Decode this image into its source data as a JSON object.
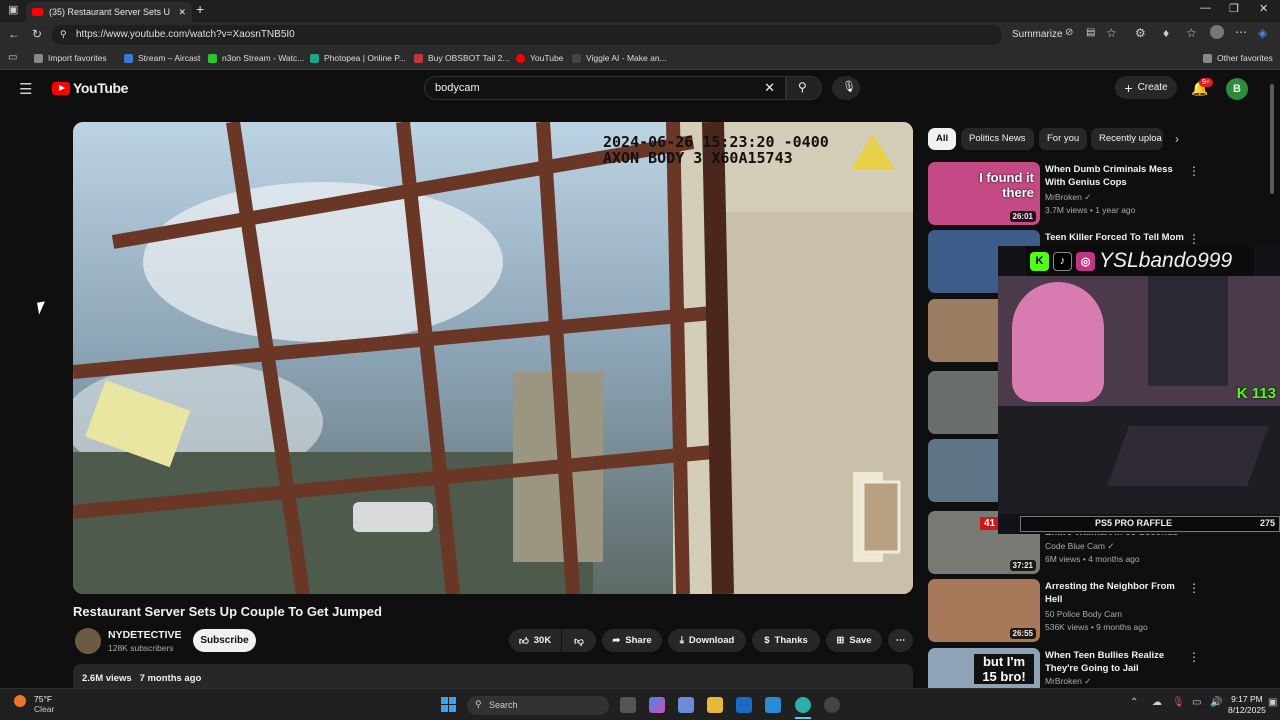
{
  "browser": {
    "tab_title": "(35) Restaurant Server Sets U",
    "url": "https://www.youtube.com/watch?v=XaosnTNB5I0",
    "summarize_label": "Summarize",
    "bookmarks": [
      "Import favorites",
      "Stream – Aircast",
      "n3on Stream - Watc...",
      "Photopea | Online P...",
      "Buy OBSBOT Tail 2...",
      "YouTube",
      "Viggle AI - Make an..."
    ],
    "other_favorites": "Other favorites"
  },
  "youtube": {
    "logo_text": "YouTube",
    "search_value": "bodycam",
    "create_label": "Create",
    "notif_badge": "9+",
    "avatar_letter": "B"
  },
  "video": {
    "overlay_line1": "2024-06-26 15:23:20 -0400",
    "overlay_line2": "AXON BODY 3 X60A15743",
    "title": "Restaurant Server Sets Up Couple To Get Jumped",
    "channel": "NYDETECTIVE",
    "subscribers": "128K subscribers",
    "subscribe_label": "Subscribe",
    "likes": "30K",
    "share_label": "Share",
    "download_label": "Download",
    "thanks_label": "Thanks",
    "save_label": "Save",
    "views": "2.6M views",
    "age": "7 months ago"
  },
  "chips": [
    "All",
    "Politics News",
    "For you",
    "Recently uploa"
  ],
  "related": [
    {
      "title": "When Dumb Criminals Mess With Genius Cops",
      "channel": "MrBroken",
      "meta": "3.7M views • 1 year ago",
      "duration": "26:01",
      "thumb_text": "I found it there",
      "color": "#c44a86"
    },
    {
      "title": "Teen Killer Forced To Tell Mom",
      "channel": "",
      "meta": "",
      "duration": "",
      "thumb_text": "",
      "color": "#3c5c8a"
    },
    {
      "title": "How One Teen Cleaned Out an Entire Walmart in 30 Seconds",
      "channel": "Code Blue Cam",
      "meta": "6M views • 4 months ago",
      "duration": "37:21",
      "thumb_text": "41",
      "color": "#7a7a74"
    },
    {
      "title": "Arresting the Neighbor From Hell",
      "channel": "50 Police Body Cam",
      "meta": "536K views • 9 months ago",
      "duration": "26:55",
      "thumb_text": "",
      "color": "#a8785a"
    },
    {
      "title": "When Teen Bullies Realize They're Going to Jail",
      "channel": "MrBroken",
      "meta": "",
      "duration": "",
      "thumb_text": "but I'm 15 bro!",
      "color": "#8fa2b8"
    }
  ],
  "stream": {
    "handle": "YSLbando999",
    "kick_count": "113",
    "bar_label": "PS5 PRO RAFFLE",
    "bar_left": "41",
    "bar_right": "275"
  },
  "taskbar": {
    "temp": "75°F",
    "weather": "Clear",
    "search_placeholder": "Search",
    "time": "9:17 PM",
    "date": "8/12/2025"
  }
}
